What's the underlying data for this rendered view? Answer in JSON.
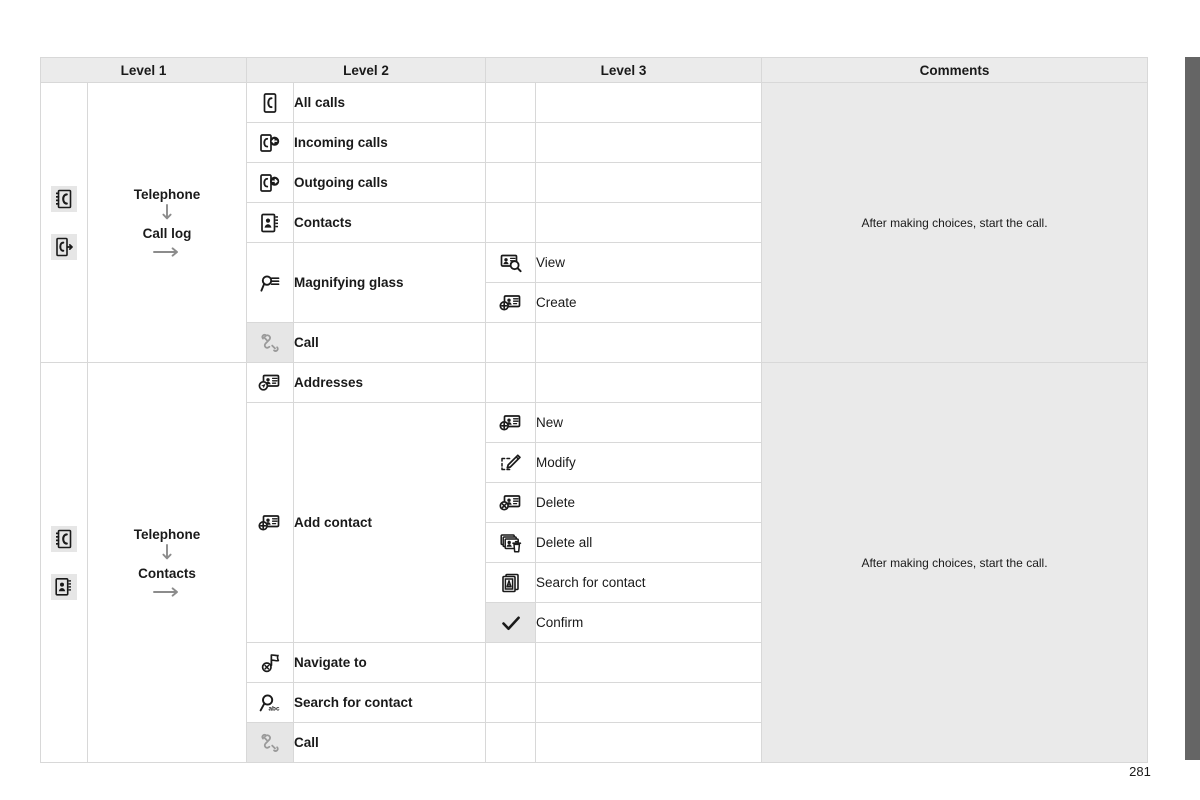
{
  "page": {
    "number": "281",
    "edge_tab_color": "#656565",
    "header_bg": "#ebebeb",
    "comment_bg": "#eaeaea",
    "shade_color": "#e6e6e6"
  },
  "table": {
    "headers": [
      "Level 1",
      "Level 2",
      "Level 3",
      "Comments"
    ],
    "sections": [
      {
        "level1": {
          "icons": [
            "phonebook-icon",
            "call-log-icon"
          ],
          "path": [
            "Telephone",
            "Call log"
          ]
        },
        "comment": "After making choices, start the call.",
        "rows": [
          {
            "level2_icon": "all-calls-icon",
            "level2": "All calls",
            "level3": []
          },
          {
            "level2_icon": "incoming-calls-icon",
            "level2": "Incoming calls",
            "level3": []
          },
          {
            "level2_icon": "outgoing-calls-icon",
            "level2": "Outgoing calls",
            "level3": []
          },
          {
            "level2_icon": "contacts-book-icon",
            "level2": "Contacts",
            "level3": []
          },
          {
            "level2_icon": "magnifying-glass-list-icon",
            "level2": "Magnifying glass",
            "level3": [
              {
                "icon": "contact-card-search-icon",
                "label": "View"
              },
              {
                "icon": "contact-card-add-icon",
                "label": "Create"
              }
            ]
          },
          {
            "level2_icon": "handset-icon",
            "level2": "Call",
            "level2_shaded": true,
            "level3": []
          }
        ]
      },
      {
        "level1": {
          "icons": [
            "phonebook-icon",
            "contacts-book-icon"
          ],
          "path": [
            "Telephone",
            "Contacts"
          ]
        },
        "comment": "After making choices, start the call.",
        "rows": [
          {
            "level2_icon": "addresses-icon",
            "level2": "Addresses",
            "level3": []
          },
          {
            "level2_icon": "contact-card-add-icon",
            "level2": "Add contact",
            "level3": [
              {
                "icon": "contact-card-add-icon",
                "label": "New"
              },
              {
                "icon": "pencil-edit-icon",
                "label": "Modify"
              },
              {
                "icon": "contact-card-delete-icon",
                "label": "Delete"
              },
              {
                "icon": "delete-all-icon",
                "label": "Delete all"
              },
              {
                "icon": "search-contact-icon",
                "label": "Search for contact"
              },
              {
                "icon": "checkmark-icon",
                "label": "Confirm",
                "shaded": true
              }
            ]
          },
          {
            "level2_icon": "navigate-to-icon",
            "level2": "Navigate to",
            "level3": []
          },
          {
            "level2_icon": "search-contact-abc-icon",
            "level2": "Search for contact",
            "level3": []
          },
          {
            "level2_icon": "handset-icon",
            "level2": "Call",
            "level2_shaded": true,
            "level3": []
          }
        ]
      }
    ]
  }
}
